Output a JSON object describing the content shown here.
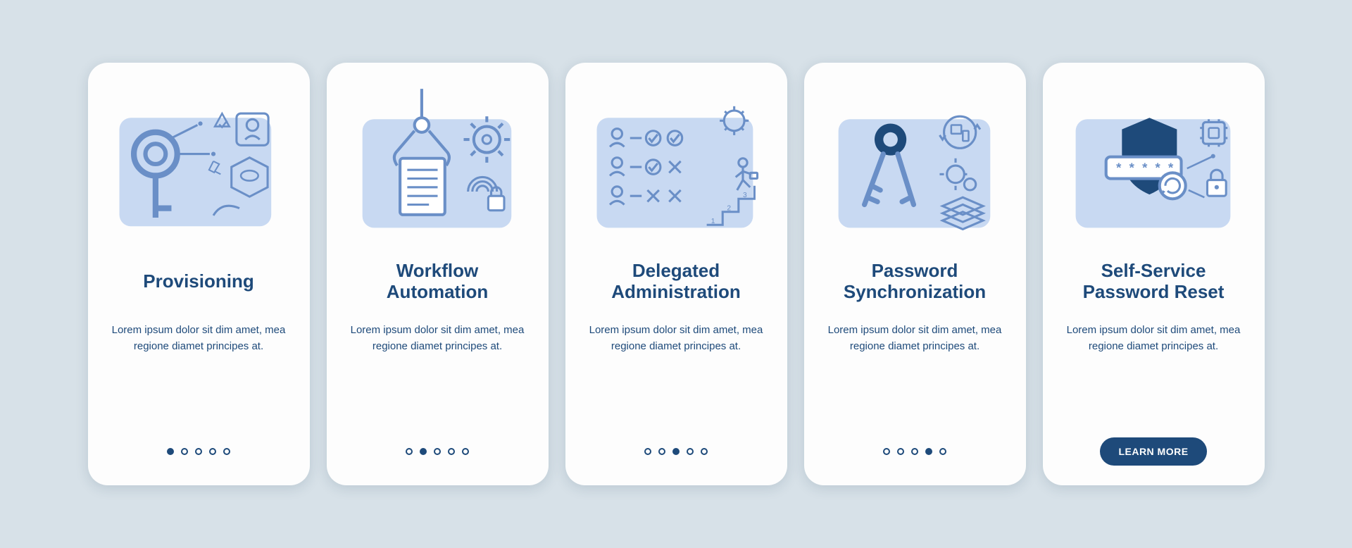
{
  "dot_count": 5,
  "cards": [
    {
      "title": "Provisioning",
      "desc": "Lorem ipsum dolor sit dim amet, mea regione diamet principes at.",
      "active_dot": 0,
      "show_cta": false
    },
    {
      "title": "Workflow\nAutomation",
      "desc": "Lorem ipsum dolor sit dim amet, mea regione diamet principes at.",
      "active_dot": 1,
      "show_cta": false
    },
    {
      "title": "Delegated\nAdministration",
      "desc": "Lorem ipsum dolor sit dim amet, mea regione diamet principes at.",
      "active_dot": 2,
      "show_cta": false
    },
    {
      "title": "Password\nSynchronization",
      "desc": "Lorem ipsum dolor sit dim amet, mea regione diamet principes at.",
      "active_dot": 3,
      "show_cta": false
    },
    {
      "title": "Self-Service\nPassword Reset",
      "desc": "Lorem ipsum dolor sit dim amet, mea regione diamet principes at.",
      "active_dot": 4,
      "show_cta": true
    }
  ],
  "cta_label": "LEARN MORE",
  "colors": {
    "accent": "#1e4a7a",
    "illus_fill": "#c8d9f2",
    "illus_stroke": "#6a8fc7",
    "bg": "#d7e1e8"
  }
}
